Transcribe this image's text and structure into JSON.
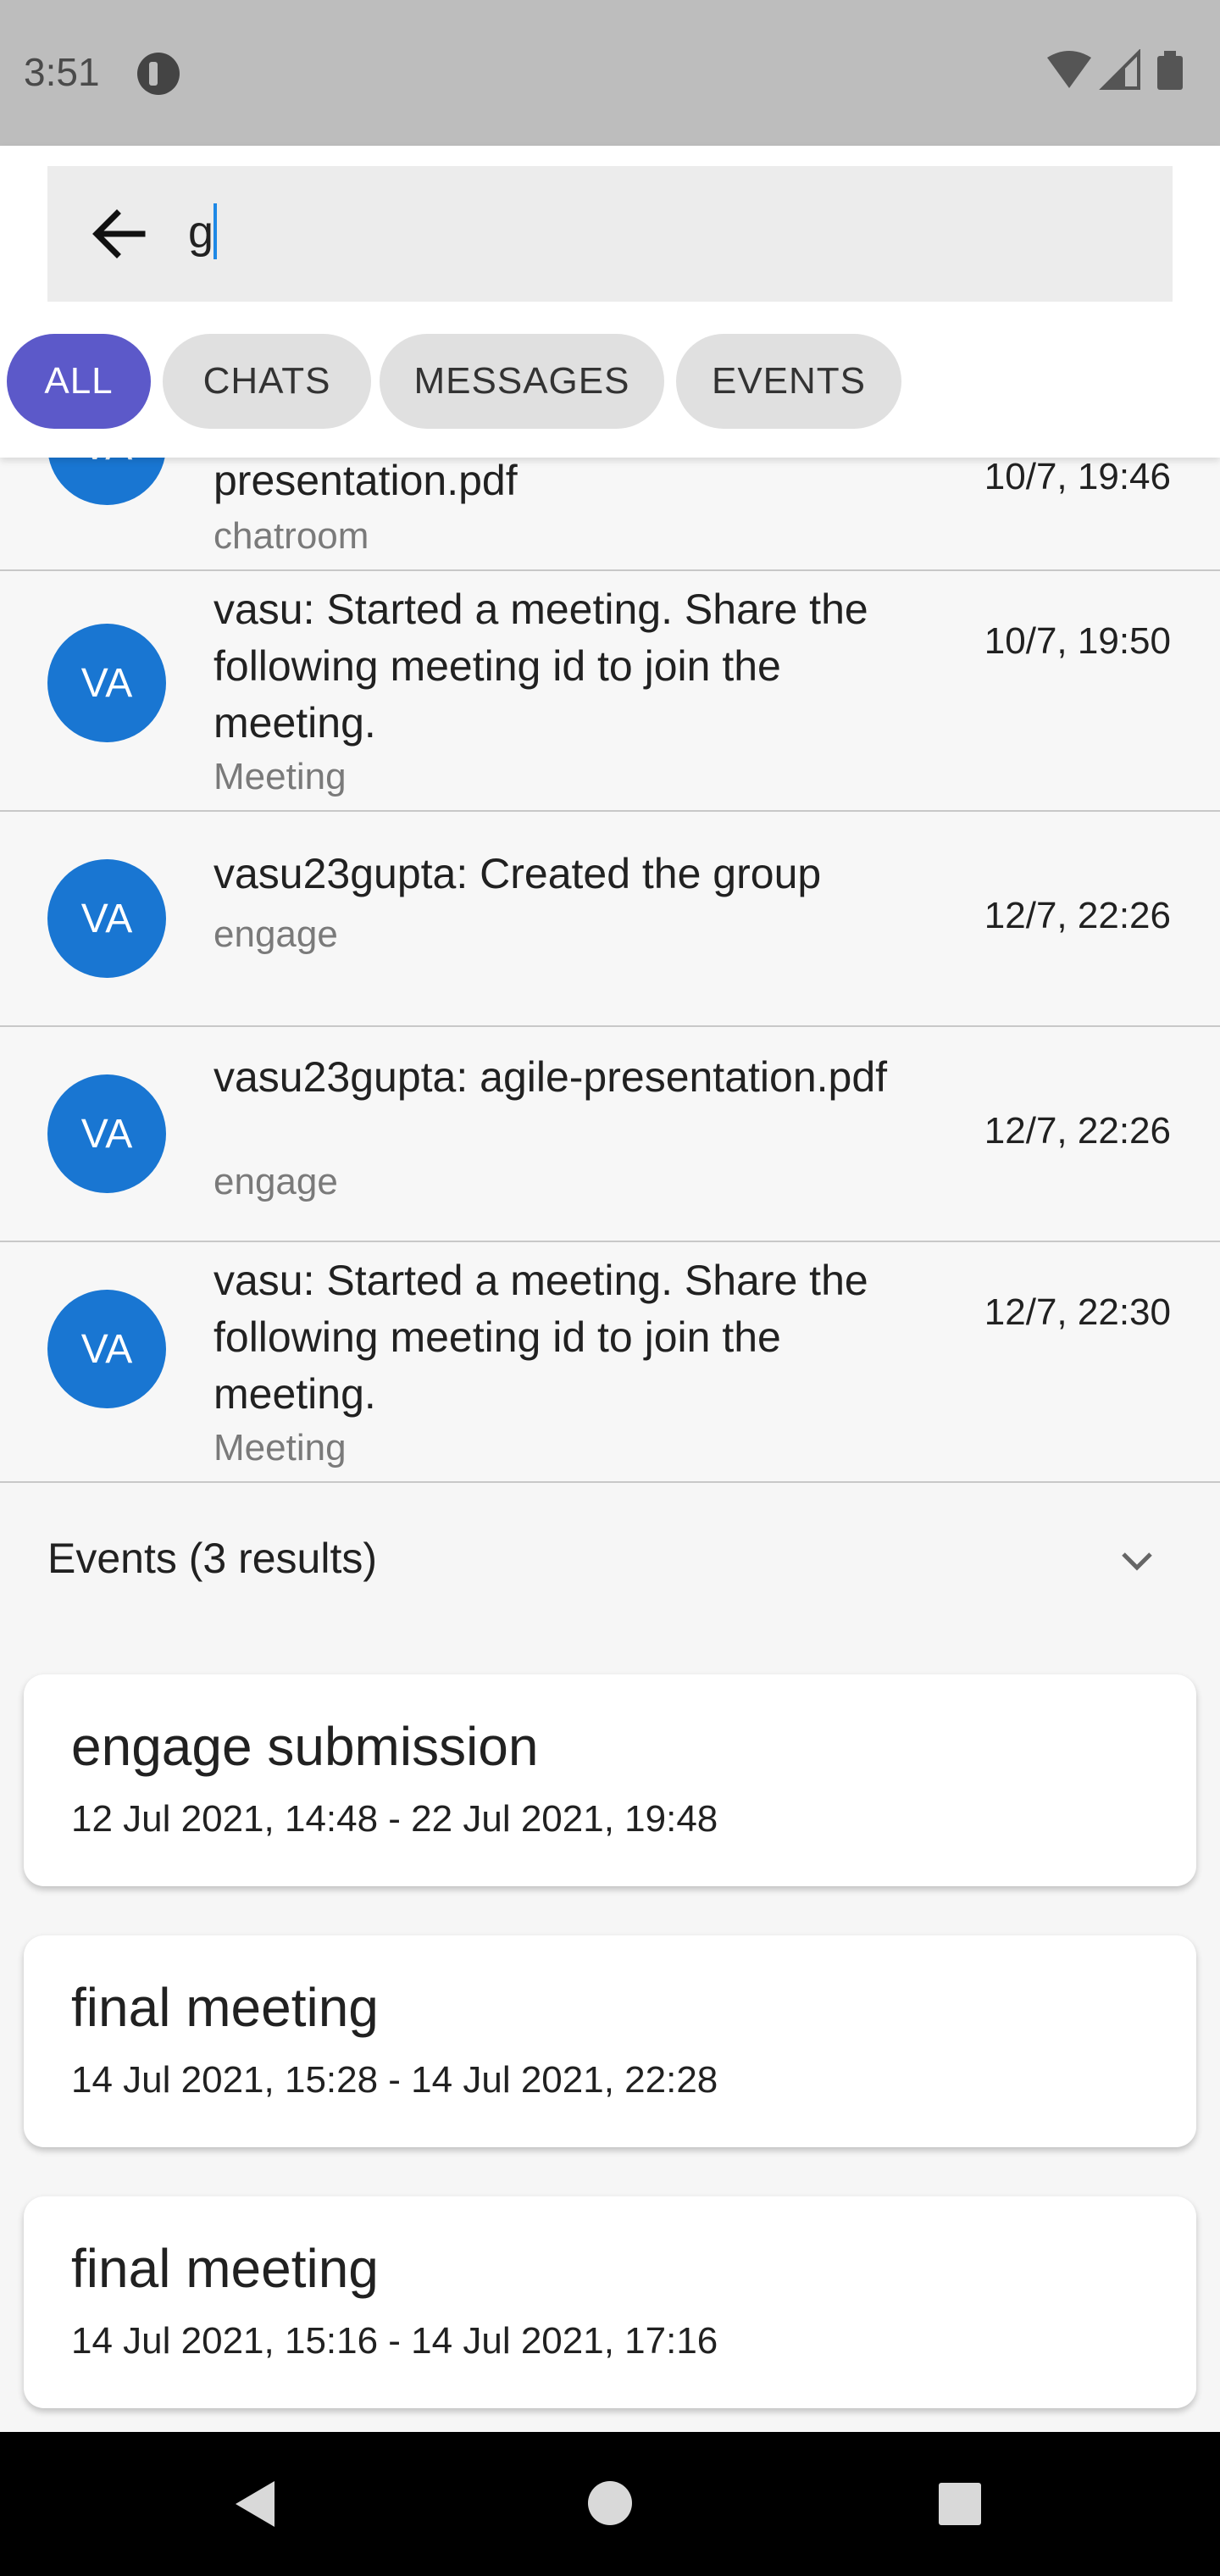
{
  "status_bar": {
    "time": "3:51"
  },
  "search": {
    "query": "g"
  },
  "filters": [
    {
      "label": "ALL",
      "active": true
    },
    {
      "label": "CHATS",
      "active": false
    },
    {
      "label": "MESSAGES",
      "active": false
    },
    {
      "label": "EVENTS",
      "active": false
    }
  ],
  "messages": [
    {
      "avatar": "VA",
      "text": "presentation.pdf",
      "source": "chatroom",
      "time": "10/7, 19:46"
    },
    {
      "avatar": "VA",
      "text": "vasu: Started a meeting. Share the following meeting id to join the meeting.",
      "source": "Meeting",
      "time": "10/7, 19:50"
    },
    {
      "avatar": "VA",
      "text": "vasu23gupta: Created the group",
      "source": "engage",
      "time": "12/7, 22:26"
    },
    {
      "avatar": "VA",
      "text": "vasu23gupta: agile-presentation.pdf",
      "source": "engage",
      "time": "12/7, 22:26"
    },
    {
      "avatar": "VA",
      "text": "vasu: Started a meeting. Share the following meeting id to join the meeting.",
      "source": "Meeting",
      "time": "12/7, 22:30"
    }
  ],
  "events_section": {
    "title": "Events  (3 results)"
  },
  "events": [
    {
      "title": "engage submission",
      "range": "12 Jul 2021, 14:48 - 22 Jul 2021, 19:48"
    },
    {
      "title": "final meeting",
      "range": "14 Jul 2021, 15:28 - 14 Jul 2021, 22:28"
    },
    {
      "title": "final meeting",
      "range": "14 Jul 2021, 15:16 - 14 Jul 2021, 17:16"
    }
  ]
}
